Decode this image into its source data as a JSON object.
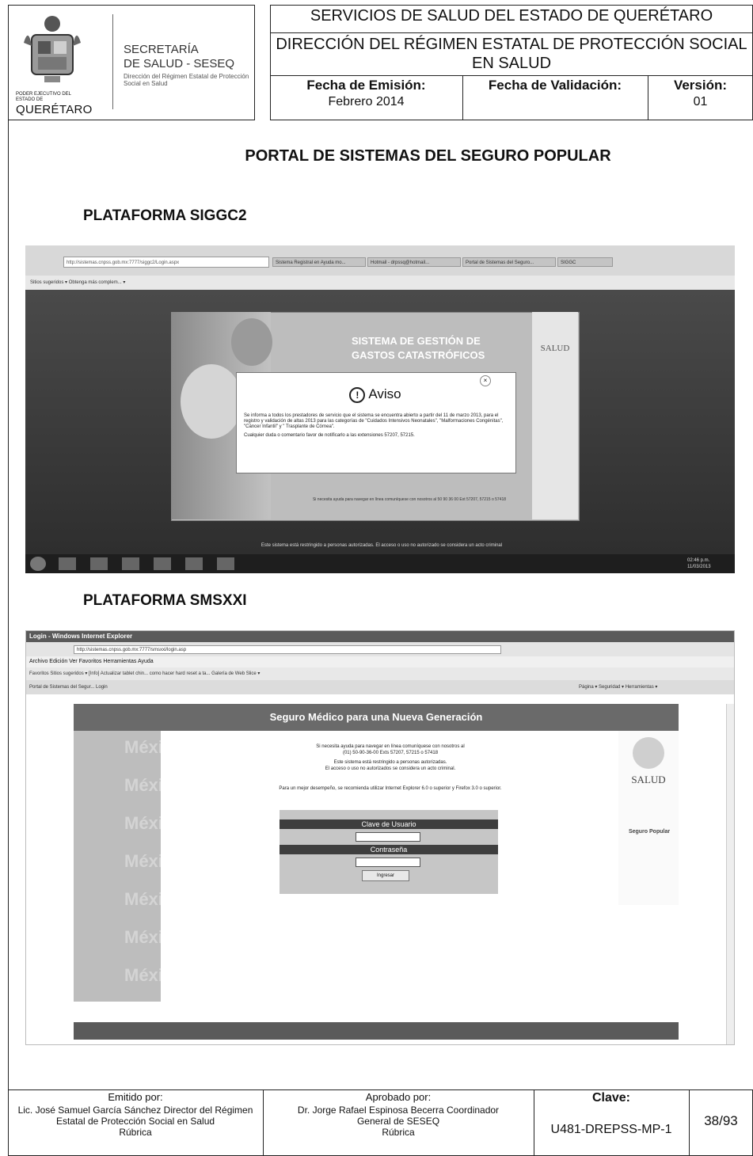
{
  "header": {
    "logo_small": "PODER EJECUTIVO DEL ESTADO DE",
    "logo_state": "QUERÉTARO",
    "secretaria_line1": "SECRETARÍA",
    "secretaria_line2": "DE SALUD - SESEQ",
    "secretaria_line3": "Dirección del Régimen Estatal de Protección Social en Salud",
    "org_title": "SERVICIOS DE SALUD DEL ESTADO DE QUERÉTARO",
    "dept_title": "DIRECCIÓN DEL RÉGIMEN ESTATAL DE PROTECCIÓN SOCIAL EN SALUD",
    "fecha_emision_label": "Fecha de Emisión:",
    "fecha_emision_value": "Febrero 2014",
    "fecha_validacion_label": "Fecha de Validación:",
    "version_label": "Versión:",
    "version_value": "01"
  },
  "content": {
    "portal_title": "PORTAL DE SISTEMAS DEL SEGURO POPULAR",
    "platform1_title": "PLATAFORMA SIGGC2",
    "platform2_title": "PLATAFORMA SMSXXI"
  },
  "screenshot1": {
    "url": "http://sistemas.cnpss.gob.mx:7777/siggc2/Login.aspx",
    "tabs": [
      "Sistema Registral en Ayuda mo...",
      "Hotmail - drpssq@hotmail...",
      "Portal de Sistemas del Seguro...",
      "SIGGC"
    ],
    "favorites": "Sitios sugeridos ▾   Obtenga más complem... ▾",
    "system_title_line1": "SISTEMA DE GESTIÓN DE",
    "system_title_line2": "GASTOS CATASTRÓFICOS",
    "salud_label": "SALUD",
    "aviso_title": "Aviso",
    "aviso_text": "Se informa a todos los prestadores de servicio que el sistema se encuentra abierto a partir del 11 de marzo 2013, para el registro y validación de altas 2013 para las categorías de \"Cuidados Intensivos Neonatales\", \"Malformaciones Congénitas\", \"Cáncer Infantil\" y \" Trasplante de Córnea\".",
    "aviso_text2": "Cualquier duda o comentario favor de notificarlo a las extensiones 57207, 57215.",
    "help_text": "Si necesita ayuda para navegar en línea comuníquese con nosotros al 50 90 36 00 Ext 57207, 57215 o 57418",
    "footer_msg": "Este sistema está restringido a personas autorizadas. El acceso o uso no autorizado se considera un acto criminal",
    "clock_time": "02:46 p.m.",
    "clock_date": "11/03/2013"
  },
  "screenshot2": {
    "window_title": "Login - Windows Internet Explorer",
    "url": "http://sistemas.cnpss.gob.mx:7777/smsxxi/login.asp",
    "menu": "Archivo   Edición   Ver   Favoritos   Herramientas   Ayuda",
    "favorites": "Favoritos   Sitios sugeridos ▾   [Info] Actualizar tablet chin...   como hacer hard reset a ta...   Galería de Web Slice ▾",
    "tabs": "Portal de Sistemas del Segur...   Login",
    "toolbar_right": "Página ▾   Seguridad ▾   Herramientas ▾",
    "banner": "Seguro Médico para una Nueva Generación",
    "watermark": "México",
    "help_line1": "Si necesita ayuda para navegar en línea comuníquese con nosotros al",
    "help_line2": "(01) 50-90-36-00 Exts 57207, 57215 o 57418",
    "help_line3": "Este sistema está restringido a personas autorizadas.",
    "help_line4": "El acceso o uso no autorizados se considera un acto criminal.",
    "recommendation": "Para un mejor desempeño, se recomienda utilizar Internet Explorer 6.0 o superior y Firefox 3.0 o superior.",
    "user_label": "Clave de Usuario",
    "password_label": "Contraseña",
    "login_button": "Ingresar",
    "salud_label": "SALUD",
    "seguro_popular": "Seguro Popular"
  },
  "footer": {
    "emitido_label": "Emitido por:",
    "emitido_text": "Lic. José Samuel García Sánchez Director del Régimen Estatal de Protección Social en Salud",
    "emitido_rubrica": "Rúbrica",
    "aprobado_label": "Aprobado por:",
    "aprobado_text": "Dr. Jorge Rafael Espinosa Becerra Coordinador General de SESEQ",
    "aprobado_rubrica": "Rúbrica",
    "clave_label": "Clave:",
    "clave_value": "U481-DREPSS-MP-1",
    "page": "38/93"
  }
}
